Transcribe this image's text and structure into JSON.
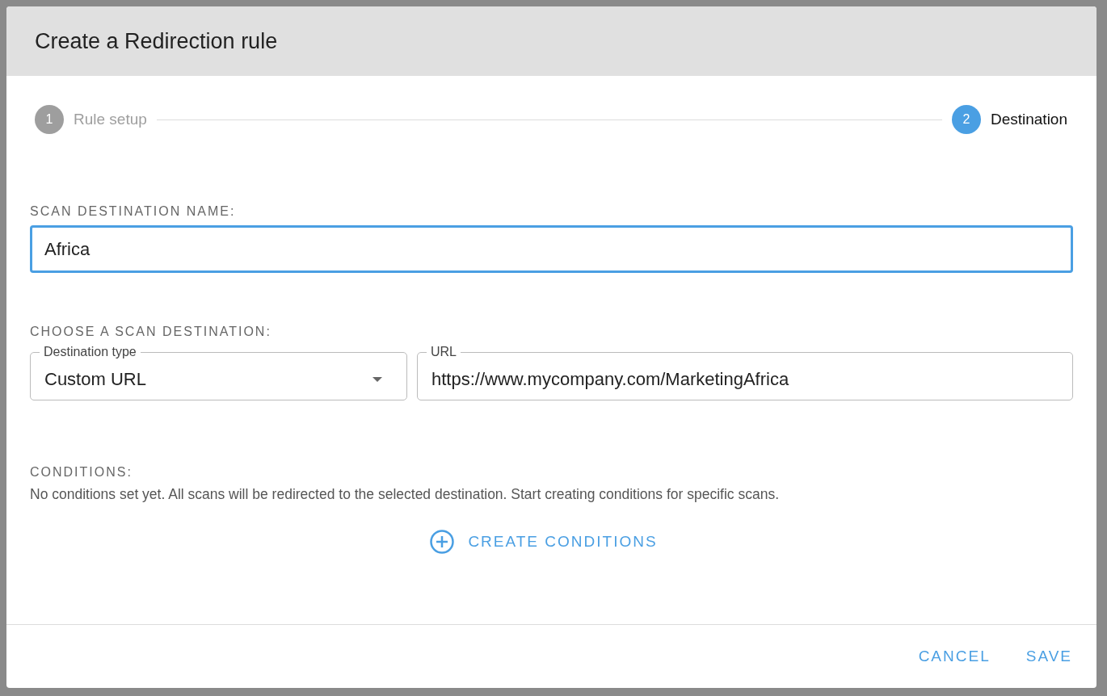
{
  "dialog": {
    "title": "Create a Redirection rule"
  },
  "steps": [
    {
      "number": "1",
      "label": "Rule setup",
      "selected": false
    },
    {
      "number": "2",
      "label": "Destination",
      "selected": true
    }
  ],
  "name_section": {
    "heading": "SCAN DESTINATION NAME:",
    "value": "Africa",
    "focused": true
  },
  "destination_section": {
    "heading": "CHOOSE A SCAN DESTINATION:",
    "type_field": {
      "label": "Destination type",
      "value": "Custom URL"
    },
    "url_field": {
      "label": "URL",
      "value": "https://www.mycompany.com/MarketingAfrica"
    }
  },
  "conditions": {
    "heading": "CONDITIONS:",
    "message": "No conditions set yet. All scans will be redirected to the selected destination. Start creating conditions for specific scans.",
    "action": "CREATE CONDITIONS"
  },
  "buttons": [
    "CANCEL",
    "SAVE"
  ]
}
